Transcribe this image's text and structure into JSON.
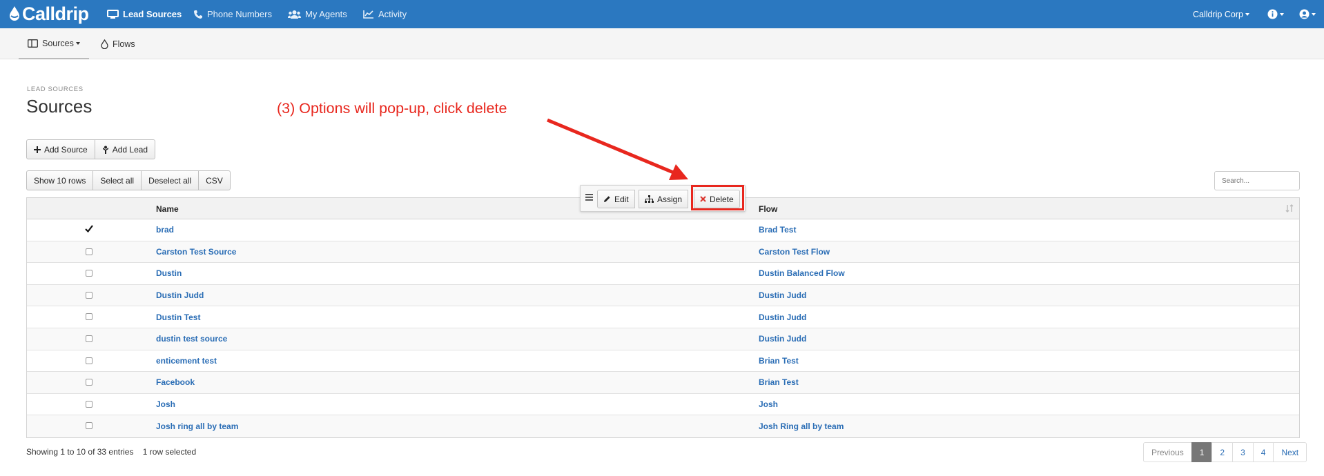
{
  "nav": {
    "brand": "Calldrip",
    "items": [
      "Lead Sources",
      "Phone Numbers",
      "My Agents",
      "Activity"
    ],
    "account": "Calldrip Corp"
  },
  "subnav": {
    "sources": "Sources",
    "flows": "Flows"
  },
  "page": {
    "breadcrumb": "LEAD SOURCES",
    "title": "Sources"
  },
  "annotation": "(3) Options will pop-up, click delete",
  "actions": {
    "add_source": "Add Source",
    "add_lead": "Add Lead"
  },
  "table_tools": {
    "show_rows": "Show 10 rows",
    "select_all": "Select all",
    "deselect_all": "Deselect all",
    "csv": "CSV"
  },
  "search": {
    "placeholder": "Search..."
  },
  "popup": {
    "edit": "Edit",
    "assign": "Assign",
    "delete": "Delete"
  },
  "table": {
    "columns": [
      "Name",
      "Flow"
    ],
    "rows": [
      {
        "name": "brad",
        "flow": "Brad Test",
        "checked": true
      },
      {
        "name": "Carston Test Source",
        "flow": "Carston Test Flow",
        "checked": false
      },
      {
        "name": "Dustin",
        "flow": "Dustin Balanced Flow",
        "checked": false
      },
      {
        "name": "Dustin Judd",
        "flow": "Dustin Judd",
        "checked": false
      },
      {
        "name": "Dustin Test",
        "flow": "Dustin Judd",
        "checked": false
      },
      {
        "name": "dustin test source",
        "flow": "Dustin Judd",
        "checked": false
      },
      {
        "name": "enticement test",
        "flow": "Brian Test",
        "checked": false
      },
      {
        "name": "Facebook",
        "flow": "Brian Test",
        "checked": false
      },
      {
        "name": "Josh",
        "flow": "Josh",
        "checked": false
      },
      {
        "name": "Josh ring all by team",
        "flow": "Josh Ring all by team",
        "checked": false
      }
    ]
  },
  "footer": {
    "showing": "Showing 1 to 10 of 33 entries",
    "selected": "1 row selected"
  },
  "pagination": [
    "Previous",
    "1",
    "2",
    "3",
    "4",
    "Next"
  ],
  "colors": {
    "nav": "#2b78c0",
    "link": "#2a6db5",
    "annotation": "#e8271e"
  }
}
